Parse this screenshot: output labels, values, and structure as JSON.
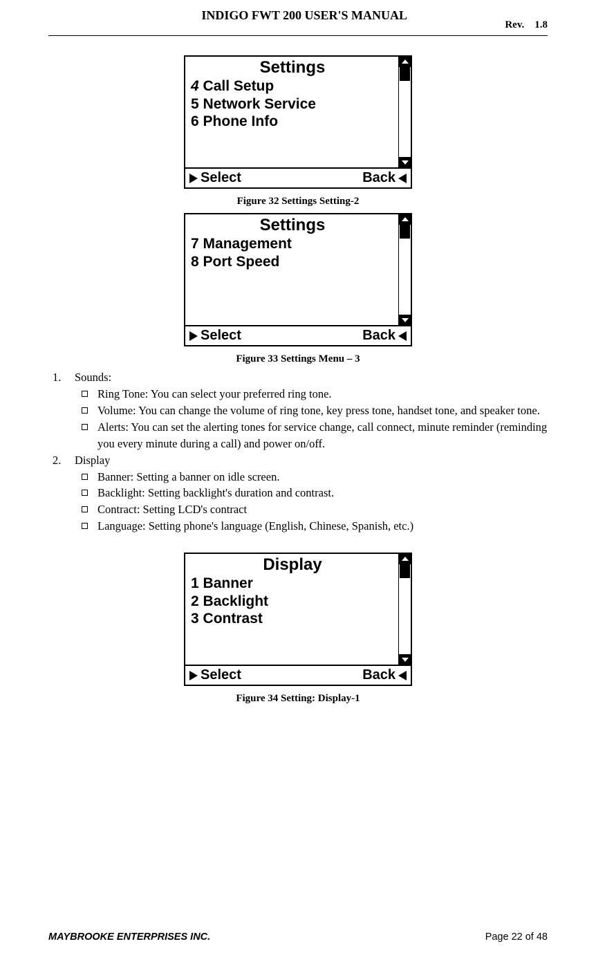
{
  "header": {
    "title": "INDIGO FWT 200 USER'S MANUAL",
    "rev_label": "Rev.",
    "rev_value": "1.8"
  },
  "screens": [
    {
      "title": "Settings",
      "lines": [
        {
          "num": "4",
          "num_italic": true,
          "text": "Call Setup"
        },
        {
          "num": "5",
          "num_italic": false,
          "text": "Network Service"
        },
        {
          "num": "6",
          "num_italic": false,
          "text": "Phone Info"
        }
      ],
      "softkey_left": "Select",
      "softkey_right": "Back",
      "caption": "Figure 32 Settings Setting-2"
    },
    {
      "title": "Settings",
      "lines": [
        {
          "num": "7",
          "num_italic": false,
          "text": "Management"
        },
        {
          "num": "8",
          "num_italic": false,
          "text": "Port Speed"
        }
      ],
      "softkey_left": "Select",
      "softkey_right": "Back",
      "caption": "Figure 33 Settings Menu – 3"
    },
    {
      "title": "Display",
      "lines": [
        {
          "num": "1",
          "num_italic": false,
          "text": "Banner"
        },
        {
          "num": "2",
          "num_italic": false,
          "text": "Backlight"
        },
        {
          "num": "3",
          "num_italic": false,
          "text": "Contrast"
        }
      ],
      "softkey_left": "Select",
      "softkey_right": "Back",
      "caption": "Figure 34 Setting: Display-1"
    }
  ],
  "body": {
    "item1_num": "1.",
    "item1_label": "Sounds:",
    "item1_subs": [
      "Ring Tone: You can select your preferred ring tone.",
      "Volume: You can change the volume of ring tone, key press tone, handset tone, and speaker tone.",
      "Alerts: You can set the alerting tones for service change, call connect, minute reminder (reminding you every minute during a call) and power on/off."
    ],
    "item2_num": "2.",
    "item2_label": "Display",
    "item2_subs": [
      "Banner:  Setting a banner on idle screen.",
      "Backlight: Setting  backlight's duration and contrast.",
      "Contract: Setting LCD's contract",
      "Language: Setting phone's language (English, Chinese, Spanish, etc.)"
    ]
  },
  "footer": {
    "company": "MAYBROOKE ENTERPRISES INC.",
    "page": "Page 22 of 48"
  }
}
